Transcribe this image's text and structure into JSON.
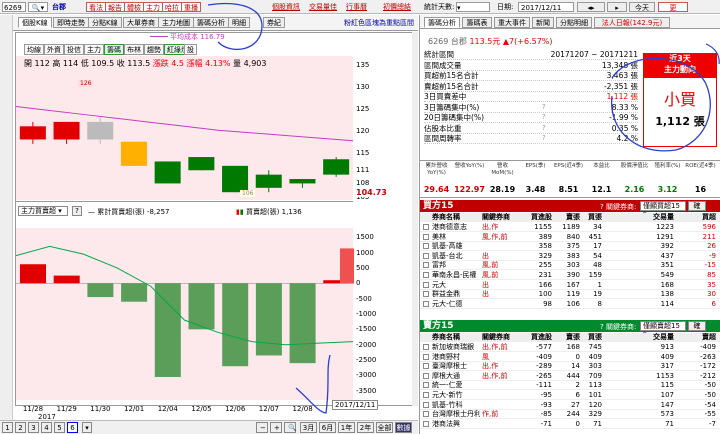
{
  "topbar": {
    "code": "6269",
    "stock": "台郡",
    "buttons": [
      "看法",
      "報告",
      "體檢",
      "主力",
      "哈拉",
      "重播"
    ],
    "links": [
      "個股資訊",
      "交易量佳",
      "行事曆",
      "初價總結"
    ],
    "days_label": "統計天數:",
    "date_label": "日期:",
    "date": "2017/12/11",
    "today": "今天",
    "update": "更"
  },
  "left_tabs": [
    "個股K線",
    "即時走勢",
    "分點K線",
    "大單券商",
    "主力地圖",
    "籌碼分析",
    "明細",
    "券紀"
  ],
  "left_note": "粉紅色區塊為重點區間",
  "tools": [
    "均線",
    "外資",
    "投信",
    "主力",
    "籌碼",
    "布林",
    "趨勢",
    "紅綠燈",
    "設"
  ],
  "ohlc": {
    "open": "開 112",
    "high": "高 114",
    "low": "低 109.5",
    "close": "收 113.5",
    "chg": "漲跌 4.5",
    "pct": "漲幅 4.13%",
    "vol": "量 4,903"
  },
  "cost_label": "平均成本 116.79",
  "price_axis": [
    "135",
    "130",
    "125",
    "120",
    "115",
    "111",
    "108",
    "105"
  ],
  "current_price": "104.73",
  "lower_select": "主力買賣超",
  "lower_legend1": "— 累計買賣超(張) -8,257",
  "lower_legend2": "買賣超(張) 1,136",
  "vol_axis": [
    "1500",
    "1000",
    "500",
    "0",
    "-500",
    "-1000",
    "-1500",
    "-2000",
    "-2500",
    "-3000",
    "-3500"
  ],
  "dates": [
    "11/28",
    "11/29",
    "11/30",
    "12/01",
    "12/04",
    "12/05",
    "12/06",
    "12/07",
    "12/08"
  ],
  "year": "2017",
  "date_tip": "2017/12/11",
  "pages": [
    "1",
    "2",
    "3",
    "4",
    "5",
    "6"
  ],
  "zoom": [
    "3月",
    "6月",
    "1年",
    "2年",
    "全部",
    "數據"
  ],
  "right_tabs": [
    "籌碼分析",
    "籌碼表",
    "重大事件",
    "新聞",
    "分點明細",
    "法人日報(142.9元)"
  ],
  "quote": {
    "code": "6269",
    "name": "台郡",
    "price": "113.5元",
    "chg": "▲7(+6.57%)"
  },
  "stats": [
    {
      "l": "統計區間",
      "v": "20171207 ~ 20171211"
    },
    {
      "l": "區間成交量",
      "v": "13,348 張"
    },
    {
      "l": "買超前15名合計",
      "v": "3,463 張"
    },
    {
      "l": "賣超前15名合計",
      "v": "-2,351 張"
    },
    {
      "l": "3日買賣差中",
      "v": "1,112 張"
    },
    {
      "l": "3日籌碼集中(%)",
      "v": "8.33 %"
    },
    {
      "l": "20日籌碼集中(%)",
      "v": "-1.99 %"
    },
    {
      "l": "佔股本比重",
      "v": "0.35 %"
    },
    {
      "l": "區間周轉率",
      "v": "4.2 %"
    }
  ],
  "signal": {
    "title": "近3天",
    "subtitle": "主力動向",
    "main": "小買",
    "value": "1,112 張"
  },
  "metrics_h": [
    "累計營收YoY(%)",
    "營收YoY(%)",
    "營收MoM(%)",
    "EPS(季)",
    "EPS(近4季)",
    "本益比",
    "股價淨值比",
    "殖利率(%)",
    "ROE(近4季)"
  ],
  "metrics_v": [
    "29.64",
    "122.97",
    "28.19",
    "3.48",
    "8.51",
    "12.1",
    "2.16",
    "3.12",
    "16"
  ],
  "buy": {
    "title": "買方15",
    "pick": "關鍵券商:",
    "sel": "僅顯買超15",
    "cols": [
      "券商名稱",
      "關鍵券商",
      "買進股",
      "賣張",
      "買張",
      "交易量",
      "買超"
    ],
    "rows": [
      [
        "港商德意志",
        "出,作",
        "1155",
        "1189",
        "34",
        "1223",
        "596"
      ],
      [
        "美林",
        "風,作,前",
        "389",
        "840",
        "451",
        "1291",
        "211"
      ],
      [
        "凱基-高雄",
        "",
        "358",
        "375",
        "17",
        "392",
        "26"
      ],
      [
        "凱基-台北",
        "出",
        "329",
        "383",
        "54",
        "437",
        "-9"
      ],
      [
        "富邦",
        "風,前",
        "255",
        "303",
        "48",
        "351",
        "-15"
      ],
      [
        "華南永昌-民權",
        "風,前",
        "231",
        "390",
        "159",
        "549",
        "85"
      ],
      [
        "元大",
        "出",
        "166",
        "167",
        "1",
        "168",
        "35"
      ],
      [
        "群益金鼎",
        "出",
        "100",
        "119",
        "19",
        "138",
        "30"
      ],
      [
        "元大-仁德",
        "",
        "98",
        "106",
        "8",
        "114",
        "6"
      ]
    ]
  },
  "sell": {
    "title": "賣方15",
    "pick": "關鍵券商:",
    "sel": "僅顯賣超15",
    "cols": [
      "券商名稱",
      "關鍵券商",
      "買進股",
      "賣張",
      "買張",
      "交易量",
      "賣超"
    ],
    "rows": [
      [
        "新加坡商瑞銀",
        "出,作,前",
        "-577",
        "168",
        "745",
        "913",
        "-409"
      ],
      [
        "港商野村",
        "風",
        "-409",
        "0",
        "409",
        "409",
        "-263"
      ],
      [
        "臺灣摩根士",
        "出,作",
        "-289",
        "14",
        "303",
        "317",
        "-172"
      ],
      [
        "摩根大通",
        "出,作,前",
        "-265",
        "444",
        "709",
        "1153",
        "-212"
      ],
      [
        "統一-仁愛",
        "",
        "-111",
        "2",
        "113",
        "115",
        "-50"
      ],
      [
        "元大-新竹",
        "",
        "-95",
        "6",
        "101",
        "107",
        "-50"
      ],
      [
        "凱基-竹科",
        "",
        "-93",
        "27",
        "120",
        "147",
        "-54"
      ],
      [
        "台灣摩根士丹利",
        "作,前",
        "-85",
        "244",
        "329",
        "573",
        "-55"
      ],
      [
        "港商法興",
        "",
        "-71",
        "0",
        "71",
        "71",
        "-7"
      ]
    ]
  },
  "colors": {
    "up": "#e00000",
    "down": "#007a00",
    "header_red": "#c00000",
    "header_green": "#008a2e",
    "cost": "#c040c0",
    "highlight": "#fde8ec"
  },
  "candles": [
    {
      "o": 121,
      "c": 118,
      "h": 122,
      "l": 117,
      "up": true
    },
    {
      "o": 122,
      "c": 118,
      "h": 122,
      "l": 117,
      "up": true
    },
    {
      "o": 118,
      "c": 122,
      "h": 123,
      "l": 117,
      "up": false,
      "gray": true
    },
    {
      "o": 117.5,
      "c": 112,
      "h": 117.5,
      "l": 112,
      "up": false,
      "yellow": true
    },
    {
      "o": 113,
      "c": 108,
      "h": 113,
      "l": 108,
      "up": false
    },
    {
      "o": 114,
      "c": 111,
      "h": 114,
      "l": 111,
      "up": false
    },
    {
      "o": 112,
      "c": 106,
      "h": 112,
      "l": 106,
      "up": false
    },
    {
      "o": 110,
      "c": 107,
      "h": 111,
      "l": 106,
      "up": false
    },
    {
      "o": 109,
      "c": 108,
      "h": 109,
      "l": 107,
      "up": false
    },
    {
      "o": 110,
      "c": 113.5,
      "h": 114,
      "l": 109.5,
      "up": false
    }
  ],
  "netbars": [
    620,
    250,
    -450,
    -600,
    -3050,
    -1500,
    -2700,
    -2350,
    -2600,
    100,
    1136
  ]
}
